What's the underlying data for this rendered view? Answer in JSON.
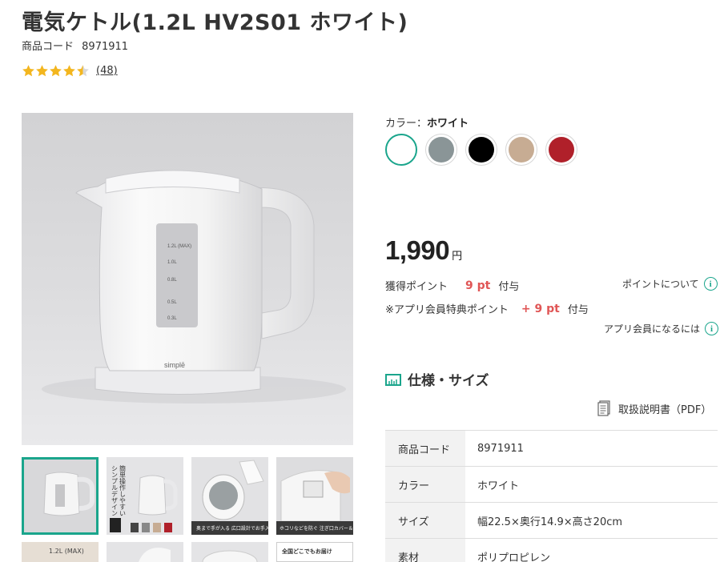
{
  "product": {
    "title": "電気ケトル(1.2L HV2S01 ホワイト)",
    "code_label": "商品コード",
    "code_value": "8971911",
    "rating_value": 4.5,
    "review_count": "(48)"
  },
  "gallery": {
    "main_image_alt": "simplē",
    "scale_marks": [
      "1.2L (MAX)",
      "1.0L",
      "0.8L",
      "0.5L",
      "0.3L"
    ],
    "thumb_texts": {
      "t2_lines": [
        "簡単操作しやすい",
        "シンプルデザイン"
      ],
      "t3_caption": "奥まで手が入る 広口設計でお手入れ簡単",
      "t4_caption": "ホコリなどを防ぐ 注ぎ口カバー＆メッシュフィルター",
      "t6_banner": "全国どこでもお届け"
    }
  },
  "color": {
    "label": "カラー：",
    "selected": "ホワイト",
    "swatches": [
      {
        "name": "white",
        "hex": "#ffffff",
        "selected": true
      },
      {
        "name": "gray",
        "hex": "#8a9597",
        "selected": false
      },
      {
        "name": "black",
        "hex": "#000000",
        "selected": false
      },
      {
        "name": "beige",
        "hex": "#c7ac93",
        "selected": false
      },
      {
        "name": "red",
        "hex": "#b0202a",
        "selected": false
      }
    ]
  },
  "price": {
    "value": "1,990",
    "unit": "円"
  },
  "points": {
    "earn_label": "獲得ポイント",
    "earn_value": "9 pt",
    "earn_suffix": "付与",
    "about_link": "ポイントについて",
    "app_label": "※アプリ会員特典ポイント",
    "app_value": "+ 9 pt",
    "app_suffix": "付与",
    "app_link": "アプリ会員になるには",
    "accent_color": "#e05656"
  },
  "specs": {
    "heading": "仕様・サイズ",
    "manual_link": "取扱説明書（PDF）",
    "rows": [
      {
        "key": "商品コード",
        "value": "8971911"
      },
      {
        "key": "カラー",
        "value": "ホワイト"
      },
      {
        "key": "サイズ",
        "value": "幅22.5×奥行14.9×高さ20cm"
      },
      {
        "key": "素材",
        "value": "ポリプロピレン"
      }
    ]
  },
  "theme": {
    "accent": "#1aa58c"
  }
}
